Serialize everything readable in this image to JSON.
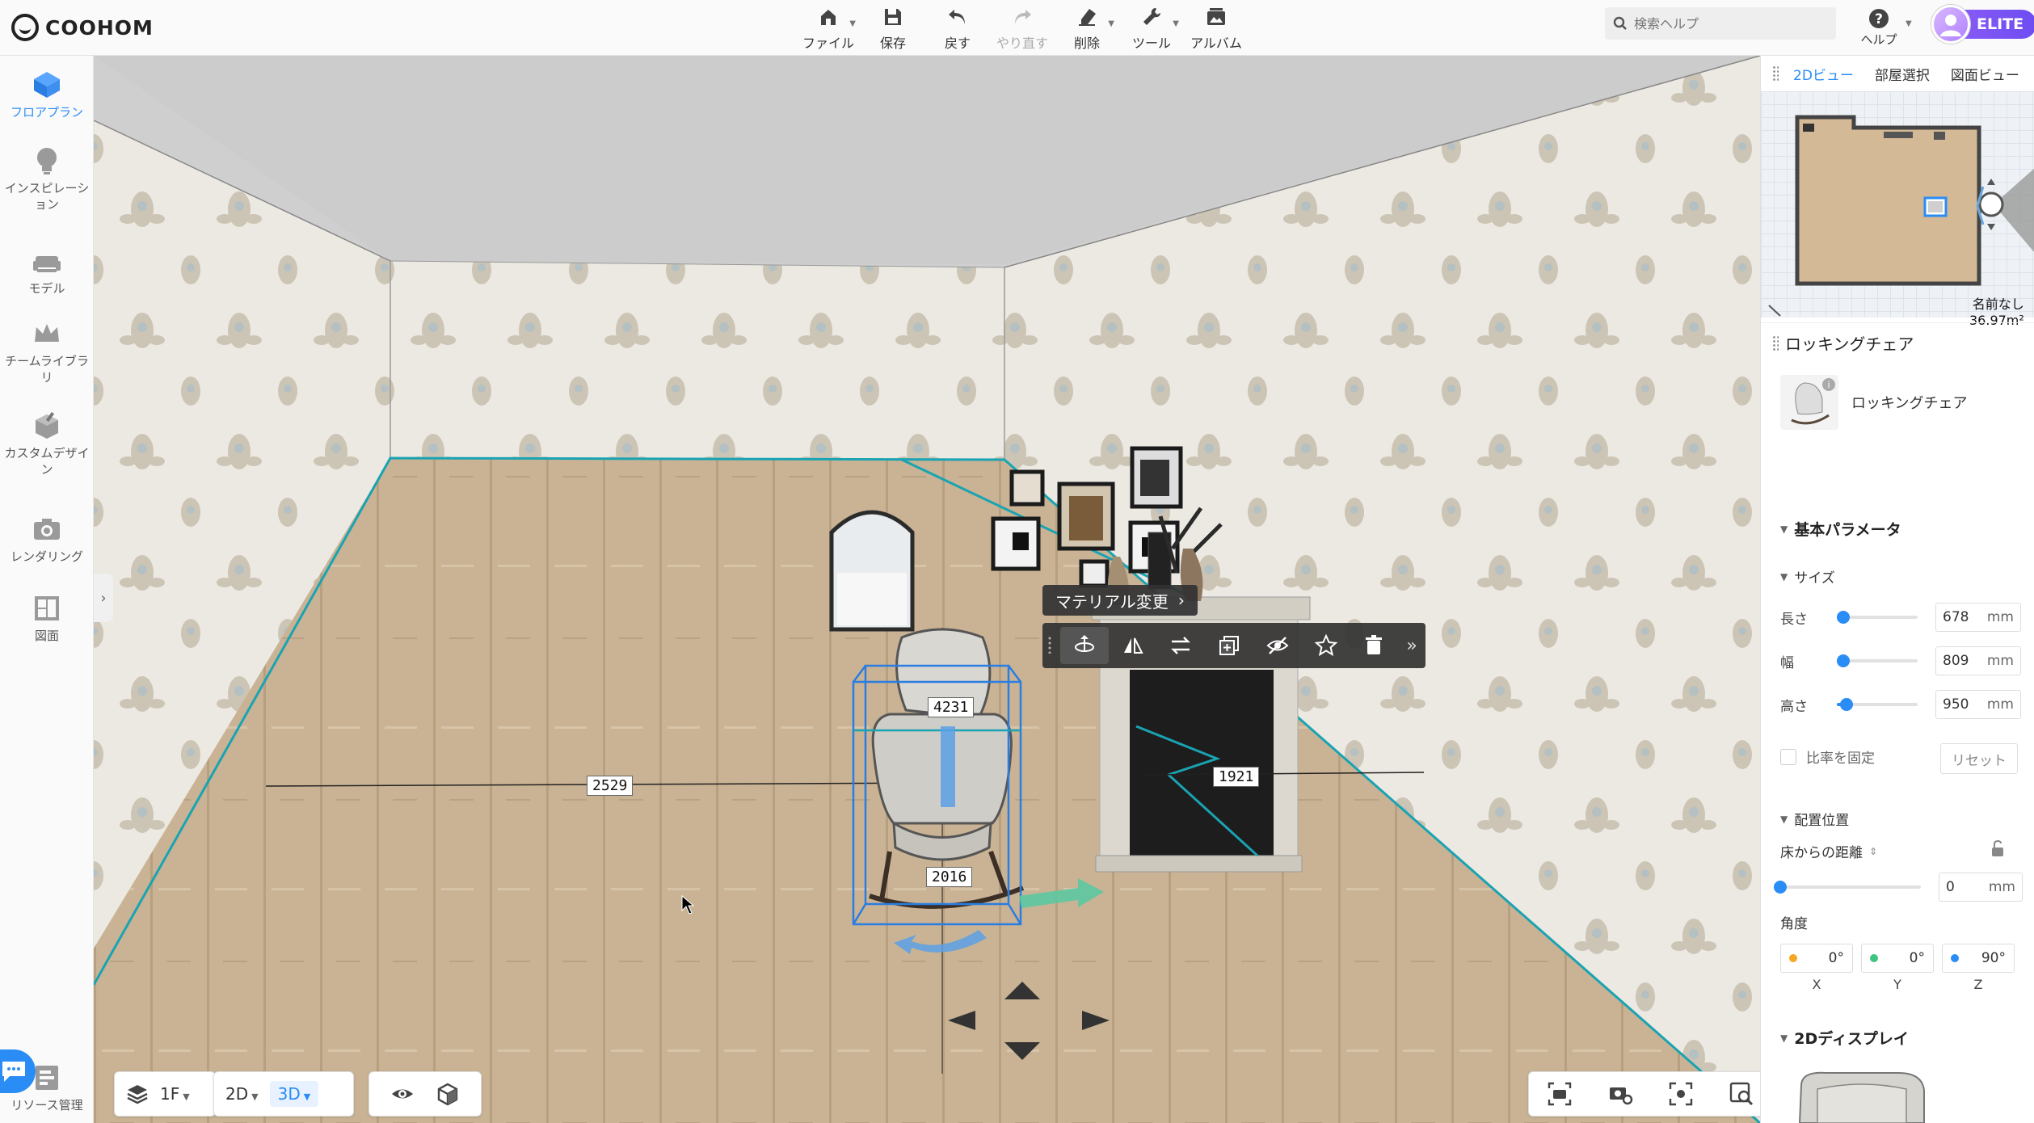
{
  "app": {
    "brand": "COOHOM"
  },
  "toolbar": {
    "items": [
      {
        "label": "ファイル",
        "icon": "house-icon",
        "caret": true
      },
      {
        "label": "保存",
        "icon": "save-icon",
        "caret": false
      },
      {
        "label": "戻す",
        "icon": "undo-icon",
        "caret": false
      },
      {
        "label": "やり直す",
        "icon": "redo-icon",
        "caret": false,
        "disabled": true
      },
      {
        "label": "削除",
        "icon": "eraser-icon",
        "caret": true
      },
      {
        "label": "ツール",
        "icon": "wrench-icon",
        "caret": true
      },
      {
        "label": "アルバム",
        "icon": "album-icon",
        "caret": false
      }
    ],
    "search_placeholder": "検索ヘルプ",
    "help_label": "ヘルプ",
    "user_badge": "ELITE"
  },
  "sidebar": {
    "items": [
      {
        "label": "フロアプラン",
        "active": true
      },
      {
        "label": "インスピレーション"
      },
      {
        "label": "モデル"
      },
      {
        "label": "チームライブラリ"
      },
      {
        "label": "カスタムデザイン"
      },
      {
        "label": "レンダリング"
      },
      {
        "label": "図面"
      }
    ],
    "bottom_label": "リソース管理"
  },
  "viewport": {
    "dimensions": {
      "top": "4231",
      "left": "2529",
      "right": "1921",
      "bottom": "2016"
    },
    "material_button": "マテリアル変更",
    "floor_selector": "1F",
    "view_2d": "2D",
    "view_3d": "3D"
  },
  "panel": {
    "view_tabs": [
      "2Dビュー",
      "部屋選択",
      "図面ビュー"
    ],
    "minimap_room_name": "名前なし",
    "minimap_room_area": "36.97m²",
    "title": "ロッキングチェア",
    "product_name": "ロッキングチェア",
    "basic_params": "基本パラメータ",
    "size_section": "サイズ",
    "size": [
      {
        "label": "長さ",
        "value": "678",
        "unit": "mm",
        "fraction": 0.08
      },
      {
        "label": "幅",
        "value": "809",
        "unit": "mm",
        "fraction": 0.08
      },
      {
        "label": "高さ",
        "value": "950",
        "unit": "mm",
        "fraction": 0.12
      }
    ],
    "lock_ratio": "比率を固定",
    "reset": "リセット",
    "placement_section": "配置位置",
    "floor_distance_label": "床からの距離",
    "floor_distance_value": "0",
    "floor_distance_unit": "mm",
    "angle_label": "角度",
    "angles": [
      {
        "axis": "X",
        "value": "0°",
        "color": "#f5a623"
      },
      {
        "axis": "Y",
        "value": "0°",
        "color": "#3fc380"
      },
      {
        "axis": "Z",
        "value": "90°",
        "color": "#2a8cf5"
      }
    ],
    "display_2d_section": "2Dディスプレイ"
  }
}
